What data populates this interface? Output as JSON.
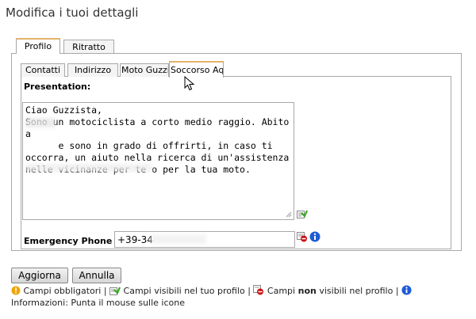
{
  "page": {
    "title": "Modifica i tuoi dettagli"
  },
  "outer_tabs": [
    {
      "label": "Profilo",
      "active": true
    },
    {
      "label": "Ritratto",
      "active": false
    }
  ],
  "inner_tabs": [
    {
      "label": "Contatti",
      "active": false
    },
    {
      "label": "Indirizzo",
      "active": false
    },
    {
      "label": "Moto Guzzi",
      "active": false
    },
    {
      "label": "Soccorso Aquile",
      "active": true
    }
  ],
  "presentation": {
    "label": "Presentation:",
    "text": "Ciao Guzzista,\nSono un motociclista a corto medio raggio. Abito a\n      e sono in grado di offrirti, in caso ti\noccorra, un aiuto nella ricerca di un'assistenza\nnelle vicinanze per te o per la tua moto.",
    "visibility_icon": "visible-in-profile-icon"
  },
  "emergency_phone": {
    "label": "Emergency Phone #:",
    "value": "+39-34",
    "visibility_icon": "not-visible-in-profile-icon",
    "info_icon": "info-icon"
  },
  "buttons": {
    "update": "Aggiorna",
    "cancel": "Annulla"
  },
  "legend": {
    "required": "Campi obbligatori |",
    "visible": "Campi visibili nel tuo profilo |",
    "not_visible_prefix": "Campi",
    "not_visible_bold": "non",
    "not_visible_suffix": "visibili nel profilo |",
    "info": "Informazioni: Punta il mouse sulle icone"
  },
  "colors": {
    "tab_accent": "#e3b36a",
    "info_blue": "#1e5bd6",
    "required_orange": "#f0a300",
    "not_visible_red": "#d01010"
  }
}
